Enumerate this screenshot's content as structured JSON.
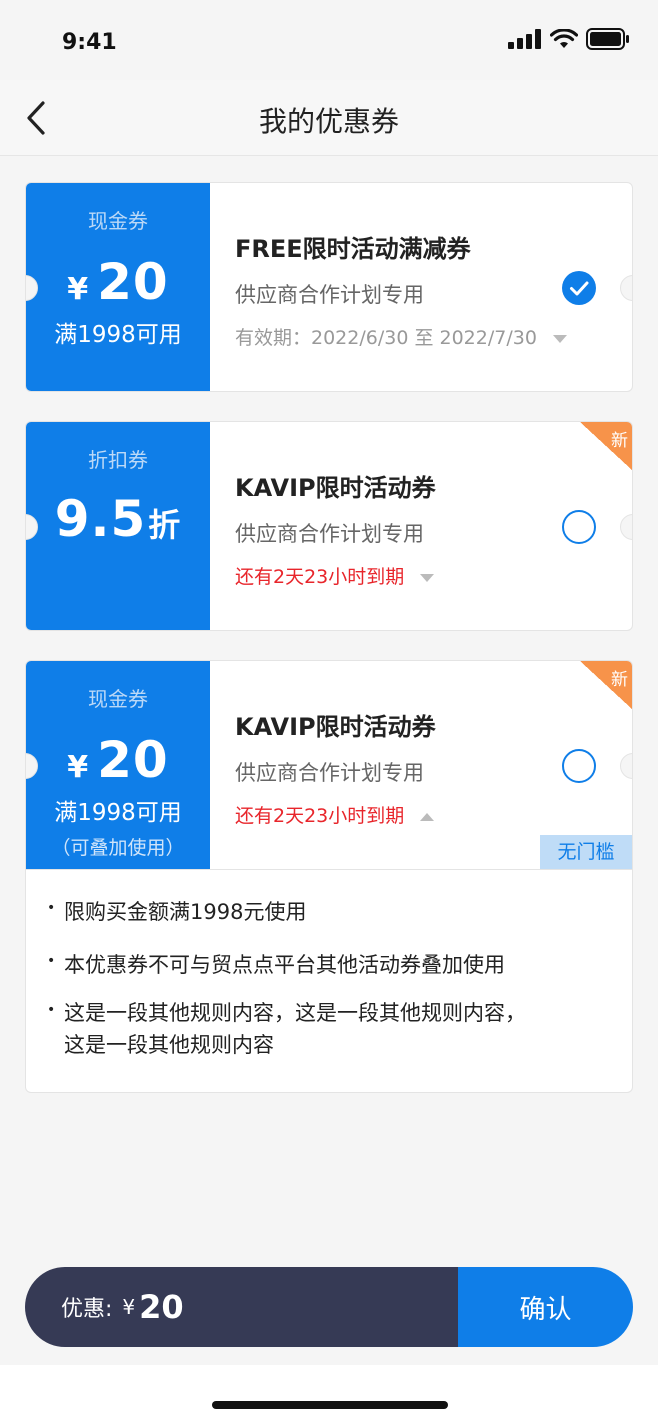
{
  "status": {
    "time": "9:41"
  },
  "nav": {
    "title": "我的优惠券"
  },
  "coupons": [
    {
      "type": "现金券",
      "currency": "¥",
      "amount": "20",
      "condition": "满1998可用",
      "title": "FREE限时活动满减券",
      "subtitle": "供应商合作计划专用",
      "validity": "有效期：2022/6/30 至 2022/7/30",
      "selected": true
    },
    {
      "type": "折扣券",
      "amount": "9.5",
      "unit": "折",
      "title": "KAVIP限时活动券",
      "subtitle": "供应商合作计划专用",
      "expire": "还有2天23小时到期",
      "badge": "新",
      "selected": false
    },
    {
      "type": "现金券",
      "currency": "¥",
      "amount": "20",
      "condition": "满1998可用",
      "note": "（可叠加使用）",
      "title": "KAVIP限时活动券",
      "subtitle": "供应商合作计划专用",
      "expire": "还有2天23小时到期",
      "badge": "新",
      "tag": "无门槛",
      "selected": false
    }
  ],
  "rules": [
    "限购买金额满1998元使用",
    "本优惠券不可与贸点点平台其他活动券叠加使用",
    "这是一段其他规则内容，这是一段其他规则内容，",
    "这是一段其他规则内容"
  ],
  "footer": {
    "discount_label": "优惠:",
    "currency": "¥",
    "amount": "20",
    "confirm_label": "确认"
  },
  "colors": {
    "primary": "#0f7ee8",
    "dark": "#363a55",
    "accent_orange": "#f7934a",
    "expire_red": "#e8252b"
  }
}
